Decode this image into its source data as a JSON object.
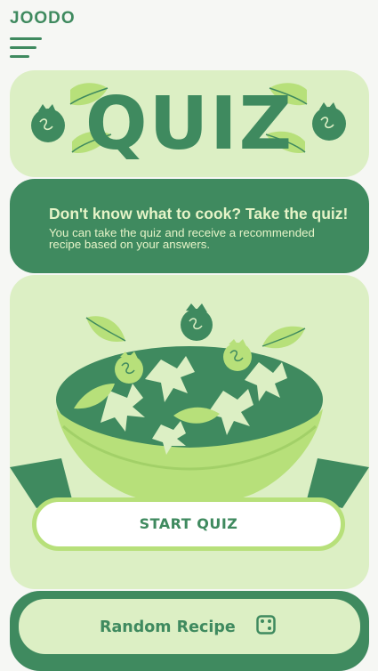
{
  "app": {
    "logo": "JOODO"
  },
  "quiz_banner": {
    "title": "QUIZ"
  },
  "intro": {
    "heading": "Don't know what to cook? Take the quiz!",
    "body": "You can take the quiz and receive a recommended recipe based on your answers."
  },
  "actions": {
    "start_label": "START QUIZ",
    "random_label": "Random Recipe"
  },
  "icons": {
    "menu": "hamburger-menu-icon",
    "dice": "dice-icon"
  },
  "colors": {
    "primary_green": "#3f8a5f",
    "light_green": "#dcefc4",
    "lime_accent": "#b7e07a",
    "background": "#f6f7f4"
  }
}
